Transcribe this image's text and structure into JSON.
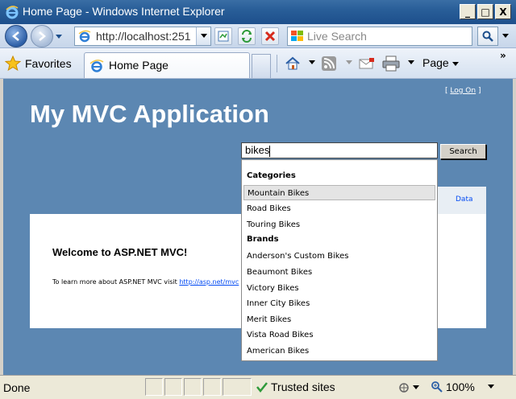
{
  "window": {
    "title": "Home Page - Windows Internet Explorer",
    "controls": {
      "minimize": "_",
      "maximize": "□",
      "close": "X"
    }
  },
  "address_bar": {
    "url": "http://localhost:251",
    "search_placeholder": "Live Search"
  },
  "command_bar": {
    "favorites_label": "Favorites",
    "tab_label": "Home Page",
    "page_menu_label": "Page",
    "more": "»"
  },
  "page": {
    "logon_left": "[ ",
    "logon_link": "Log On",
    "logon_right": " ]",
    "app_title": "My MVC Application",
    "search_value": "bikes",
    "search_button": "Search",
    "menu_item": "Data",
    "welcome_heading": "Welcome to ASP.NET MVC!",
    "learn_more_text": "To learn more about ASP.NET MVC visit ",
    "learn_more_link": "http://asp.net/mvc"
  },
  "autocomplete": {
    "categories_header": "Categories",
    "categories": [
      "Mountain Bikes",
      "Road Bikes",
      "Touring Bikes"
    ],
    "brands_header": "Brands",
    "brands": [
      "Anderson's Custom Bikes",
      "Beaumont Bikes",
      "Victory Bikes",
      "Inner City Bikes",
      "Merit Bikes",
      "Vista Road Bikes",
      "American Bikes"
    ],
    "selected": "Mountain Bikes"
  },
  "status_bar": {
    "status": "Done",
    "zone": "Trusted sites",
    "zoom": "100%"
  },
  "colors": {
    "page_background": "#5c87b2",
    "link": "#034af3",
    "titlebar": "#295e98"
  }
}
